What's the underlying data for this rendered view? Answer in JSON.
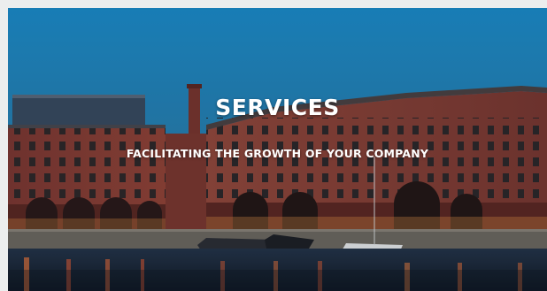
{
  "hero": {
    "title": "SERVICES",
    "subtitle": "FACILITATING THE GROWTH OF YOUR COMPANY"
  },
  "colors": {
    "sky_top": "#1d8fcd",
    "sky_bottom": "#2e6f92",
    "brick": "#8a3f37",
    "water": "#1b2a3e"
  }
}
